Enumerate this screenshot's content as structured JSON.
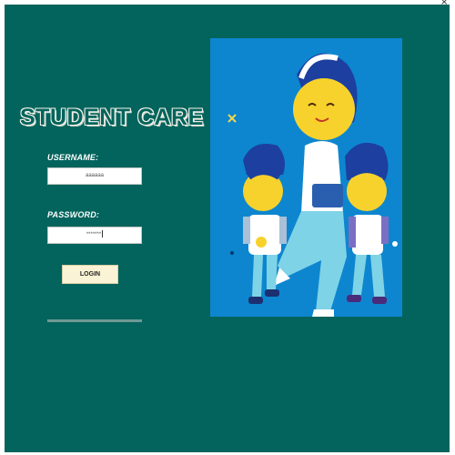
{
  "window": {
    "close_glyph": "×"
  },
  "app": {
    "title": "STUDENT CARE"
  },
  "form": {
    "username_label": "USERNAME:",
    "username_value": "aaaaaa",
    "password_label": "PASSWORD:",
    "password_value": "*******",
    "login_label": "LOGIN"
  },
  "illustration": {
    "description_icon": "teacher-with-children-illustration"
  },
  "colors": {
    "background": "#02645c",
    "illustration_bg": "#0d86cf",
    "title_outline": "#f4f1e8",
    "button_bg": "#fbf3d5",
    "divider": "#6f9994"
  }
}
